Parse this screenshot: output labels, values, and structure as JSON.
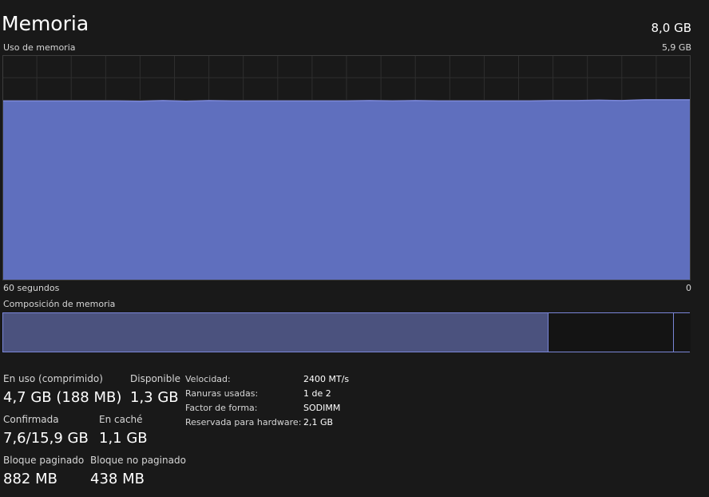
{
  "header": {
    "title": "Memoria",
    "total": "8,0 GB"
  },
  "usage_graph": {
    "label": "Uso de memoria",
    "max_label": "5,9 GB",
    "time_left": "60 segundos",
    "time_right": "0",
    "fill_color": "#5f6fbe",
    "line_color": "#7a86d8"
  },
  "chart_data": {
    "type": "area",
    "ylim": [
      0,
      5.9
    ],
    "x": [
      60,
      58,
      56,
      54,
      52,
      50,
      48,
      46,
      44,
      42,
      40,
      38,
      36,
      34,
      32,
      30,
      28,
      26,
      24,
      22,
      20,
      18,
      16,
      14,
      12,
      10,
      8,
      6,
      4,
      2,
      0
    ],
    "series": [
      {
        "values": [
          4.7,
          4.7,
          4.7,
          4.7,
          4.7,
          4.7,
          4.69,
          4.71,
          4.69,
          4.71,
          4.7,
          4.7,
          4.7,
          4.7,
          4.7,
          4.7,
          4.71,
          4.7,
          4.71,
          4.7,
          4.7,
          4.7,
          4.7,
          4.7,
          4.71,
          4.71,
          4.72,
          4.71,
          4.73,
          4.73,
          4.73
        ]
      }
    ]
  },
  "composition": {
    "label": "Composición de memoria"
  },
  "stats": {
    "in_use_label": "En uso (comprimido)",
    "in_use_value": "4,7 GB (188 MB)",
    "available_label": "Disponible",
    "available_value": "1,3 GB",
    "committed_label": "Confirmada",
    "committed_value": "7,6/15,9 GB",
    "cached_label": "En caché",
    "cached_value": "1,1 GB",
    "paged_label": "Bloque paginado",
    "paged_value": "882 MB",
    "nonpaged_label": "Bloque no paginado",
    "nonpaged_value": "438 MB"
  },
  "properties": {
    "speed_label": "Velocidad:",
    "speed_value": "2400 MT/s",
    "slots_label": "Ranuras usadas:",
    "slots_value": "1 de 2",
    "form_label": "Factor de forma:",
    "form_value": "SODIMM",
    "reserved_label": "Reservada para hardware:",
    "reserved_value": "2,1 GB"
  }
}
